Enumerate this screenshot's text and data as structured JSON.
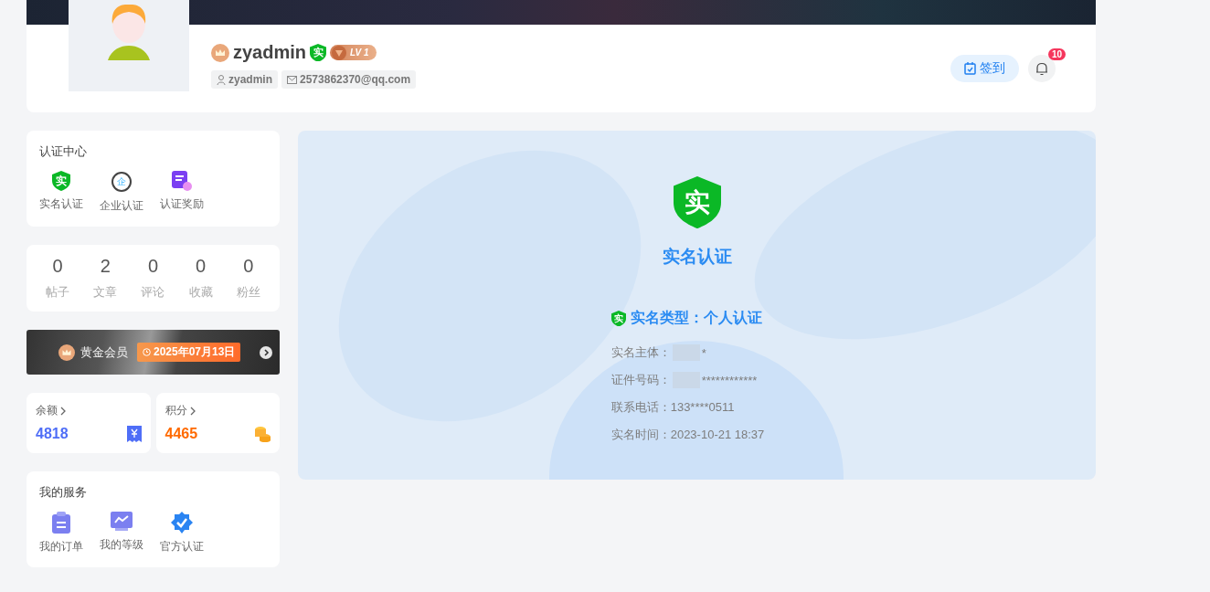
{
  "profile": {
    "username": "zyadmin",
    "verified_badge": "实",
    "level": "LV 1",
    "account": "zyadmin",
    "email": "2573862370@qq.com",
    "checkin": "签到",
    "notifications": "10"
  },
  "cert_center": {
    "title": "认证中心",
    "items": [
      {
        "kind": "shield",
        "icon_text": "实",
        "label": "实名认证"
      },
      {
        "kind": "circle",
        "icon_text": "企",
        "label": "企业认证"
      },
      {
        "kind": "doc",
        "label": "认证奖励"
      }
    ]
  },
  "stats": [
    {
      "value": "0",
      "label": "帖子"
    },
    {
      "value": "2",
      "label": "文章"
    },
    {
      "value": "0",
      "label": "评论"
    },
    {
      "value": "0",
      "label": "收藏"
    },
    {
      "value": "0",
      "label": "粉丝"
    }
  ],
  "vip": {
    "label": "黄金会员",
    "expiry": "2025年07月13日"
  },
  "wallet": [
    {
      "kind": "balance",
      "label": "余额",
      "value": "4818",
      "color": "#4f6ef7"
    },
    {
      "kind": "points",
      "label": "积分",
      "value": "4465",
      "color": "#ff6a00"
    }
  ],
  "services": {
    "title": "我的服务",
    "items": [
      {
        "kind": "order",
        "label": "我的订单"
      },
      {
        "kind": "level",
        "label": "我的等级"
      },
      {
        "kind": "official",
        "label": "官方认证"
      }
    ]
  },
  "verification": {
    "badge": "实",
    "title": "实名认证",
    "type_badge": "实",
    "type": "实名类型：个人认证",
    "fields": [
      {
        "label": "实名主体：",
        "value": "*",
        "redacted": true
      },
      {
        "label": "证件号码：",
        "value": "************",
        "redacted": true
      },
      {
        "label": "联系电话：",
        "value": "133****0511",
        "redacted": false
      },
      {
        "label": "实名时间：",
        "value": "2023-10-21 18:37",
        "redacted": false
      }
    ]
  }
}
